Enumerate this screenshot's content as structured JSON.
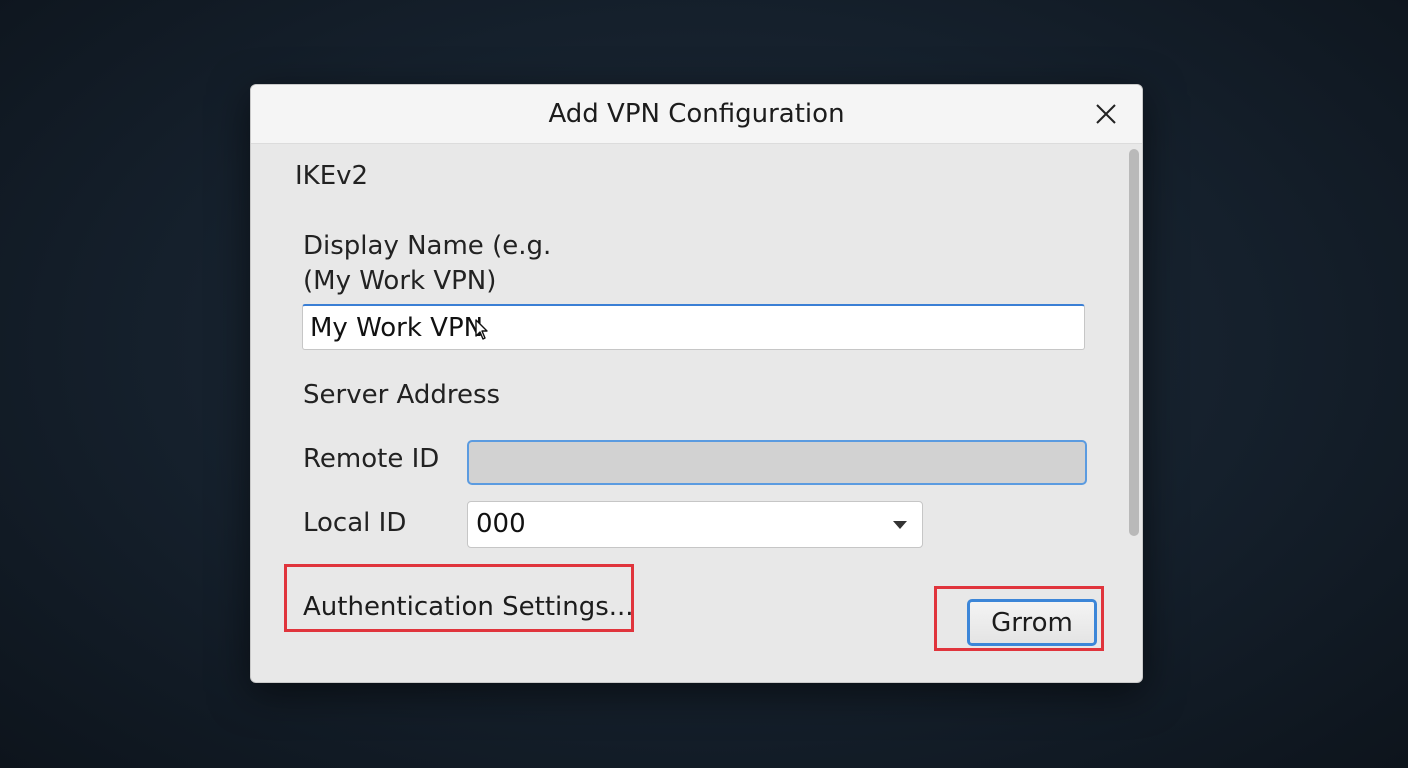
{
  "dialog": {
    "title": "Add VPN Configuration",
    "close_icon": "close-icon"
  },
  "form": {
    "protocol": "IKEv2",
    "display_name": {
      "label_line1": "Display Name (e.g.",
      "label_line2": "(My Work VPN)",
      "value": "My Work VPN"
    },
    "server_address": {
      "label": "Server Address"
    },
    "remote_id": {
      "label": "Remote ID",
      "value": ""
    },
    "local_id": {
      "label": "Local ID",
      "value": "000",
      "icon": "chevron-down-icon"
    },
    "auth_settings_label": "Authentication Settings...",
    "action_button_label": "Grrom"
  },
  "colors": {
    "highlight": "#e0343c",
    "accent": "#3c86d8",
    "dialog_bg": "#e8e8e8",
    "backdrop": "#15202c"
  }
}
